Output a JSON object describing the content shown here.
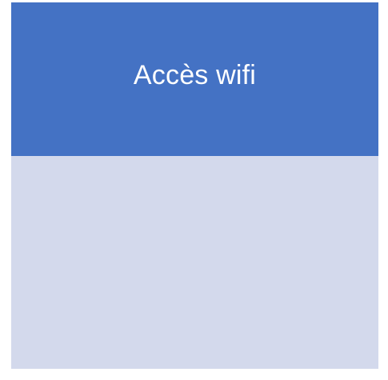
{
  "card": {
    "title": "Accès wifi",
    "header_color": "#4472C4",
    "body_color": "#D3D9EC",
    "title_color": "#FFFFFF"
  }
}
